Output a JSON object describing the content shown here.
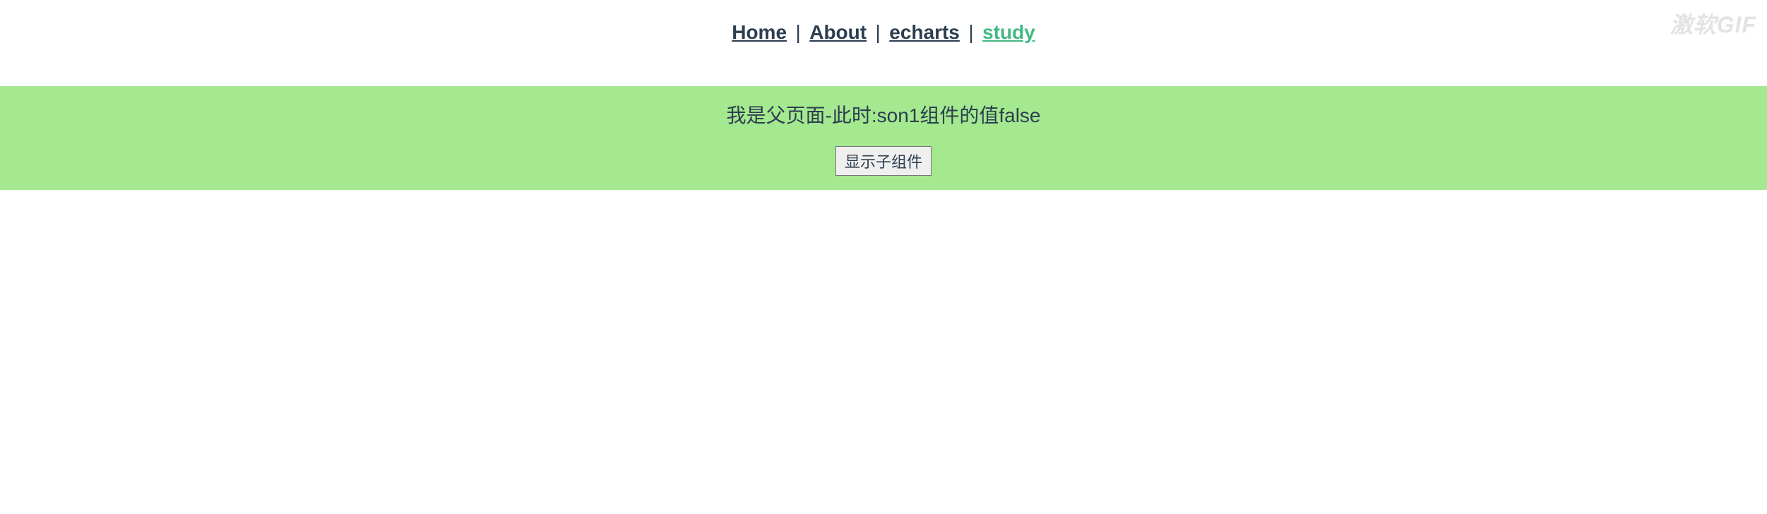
{
  "nav": {
    "links": [
      {
        "label": "Home",
        "active": false
      },
      {
        "label": "About",
        "active": false
      },
      {
        "label": "echarts",
        "active": false
      },
      {
        "label": "study",
        "active": true
      }
    ],
    "separator": "|"
  },
  "panel": {
    "title": "我是父页面-此时:son1组件的值false",
    "button_label": "显示子组件"
  },
  "watermark": "激软GIF"
}
